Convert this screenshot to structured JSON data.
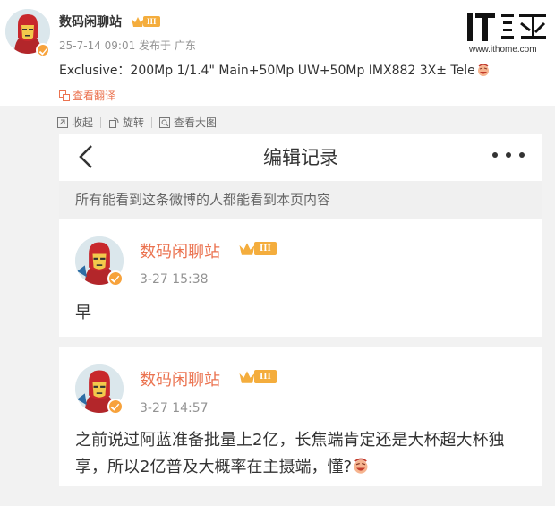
{
  "post": {
    "author": "数码闲聊站",
    "level": "III",
    "meta": "25-7-14 09:01  发布于 广东",
    "content": "Exclusive：200Mp 1/1.4\" Main+50Mp UW+50Mp IMX882 3X± Tele",
    "translate": "查看翻译"
  },
  "logo": {
    "site": "www.ithome.com"
  },
  "toolbar": {
    "collapse": "收起",
    "rotate": "旋转",
    "view_large": "查看大图"
  },
  "panel": {
    "title": "编辑记录",
    "notice": "所有能看到这条微博的人都能看到本页内容",
    "records": [
      {
        "author": "数码闲聊站",
        "level": "III",
        "time": "3-27 15:38",
        "text": "早"
      },
      {
        "author": "数码闲聊站",
        "level": "III",
        "time": "3-27 14:57",
        "text": "之前说过阿蓝准备批量上2亿，长焦端肯定还是大杯超大杯独享，所以2亿普及大概率在主摄端，懂?"
      }
    ]
  },
  "colors": {
    "accent": "#eb7350",
    "badge": "#f4ad3d",
    "verified": "#f7a23b"
  }
}
